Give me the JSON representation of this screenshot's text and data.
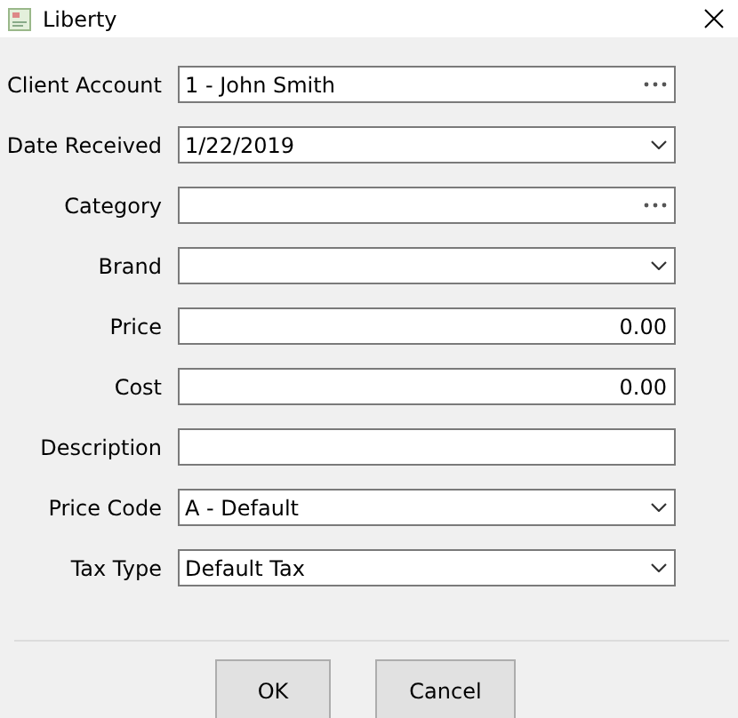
{
  "window": {
    "title": "Liberty"
  },
  "fields": [
    {
      "label": "Client Account",
      "kind": "lookup",
      "value": "1 - John Smith"
    },
    {
      "label": "Date Received",
      "kind": "dropdown",
      "value": "1/22/2019"
    },
    {
      "label": "Category",
      "kind": "lookup"
    },
    {
      "label": "Brand",
      "kind": "dropdown"
    },
    {
      "label": "Price",
      "kind": "number",
      "value": "0.00"
    },
    {
      "label": "Cost",
      "kind": "number",
      "value": "0.00"
    },
    {
      "label": "Description",
      "kind": "text"
    },
    {
      "label": "Price Code",
      "kind": "dropdown",
      "value": "A - Default"
    },
    {
      "label": "Tax Type",
      "kind": "dropdown",
      "value": "Default Tax"
    }
  ],
  "buttons": [
    "OK",
    "Cancel"
  ]
}
